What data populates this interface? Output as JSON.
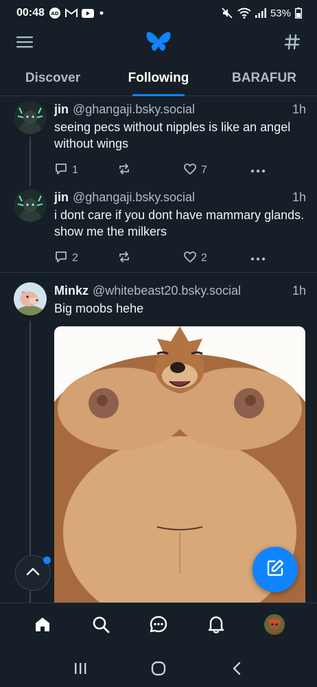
{
  "status_bar": {
    "time": "00:48",
    "battery": "53%",
    "icons": [
      "ad-notification-icon",
      "mail-icon",
      "youtube-icon",
      "dot-icon",
      "mute-icon",
      "wifi-icon",
      "signal-icon",
      "battery-icon"
    ]
  },
  "header": {
    "menu_icon": "hamburger-menu-icon",
    "logo_icon": "bluesky-butterfly-icon",
    "feeds_icon": "hashtag-icon"
  },
  "tabs": [
    {
      "label": "Discover",
      "active": false
    },
    {
      "label": "Following",
      "active": true
    },
    {
      "label": "BARAFUR",
      "active": false
    }
  ],
  "posts": [
    {
      "author": "jin",
      "handle": "@ghangaji.bsky.social",
      "time": "1h",
      "text": "seeing pecs without nipples is like an angel without wings",
      "replies": "1",
      "reposts": "",
      "likes": "7"
    },
    {
      "author": "jin",
      "handle": "@ghangaji.bsky.social",
      "time": "1h",
      "text": "i dont care if you dont have mammary glands. show me the milkers",
      "replies": "2",
      "reposts": "",
      "likes": "2"
    },
    {
      "author": "Minkz",
      "handle": "@whitebeast20.bsky.social",
      "time": "1h",
      "text": "Big moobs hehe"
    }
  ],
  "bottom_nav": [
    "home-icon",
    "search-icon",
    "chat-icon",
    "notifications-icon",
    "profile-avatar"
  ],
  "system_nav": [
    "recents-icon",
    "home-circle-icon",
    "back-icon"
  ],
  "colors": {
    "background": "#161e27",
    "accent": "#1083fe",
    "muted_text": "#aebbc9",
    "divider": "#2b3643"
  }
}
